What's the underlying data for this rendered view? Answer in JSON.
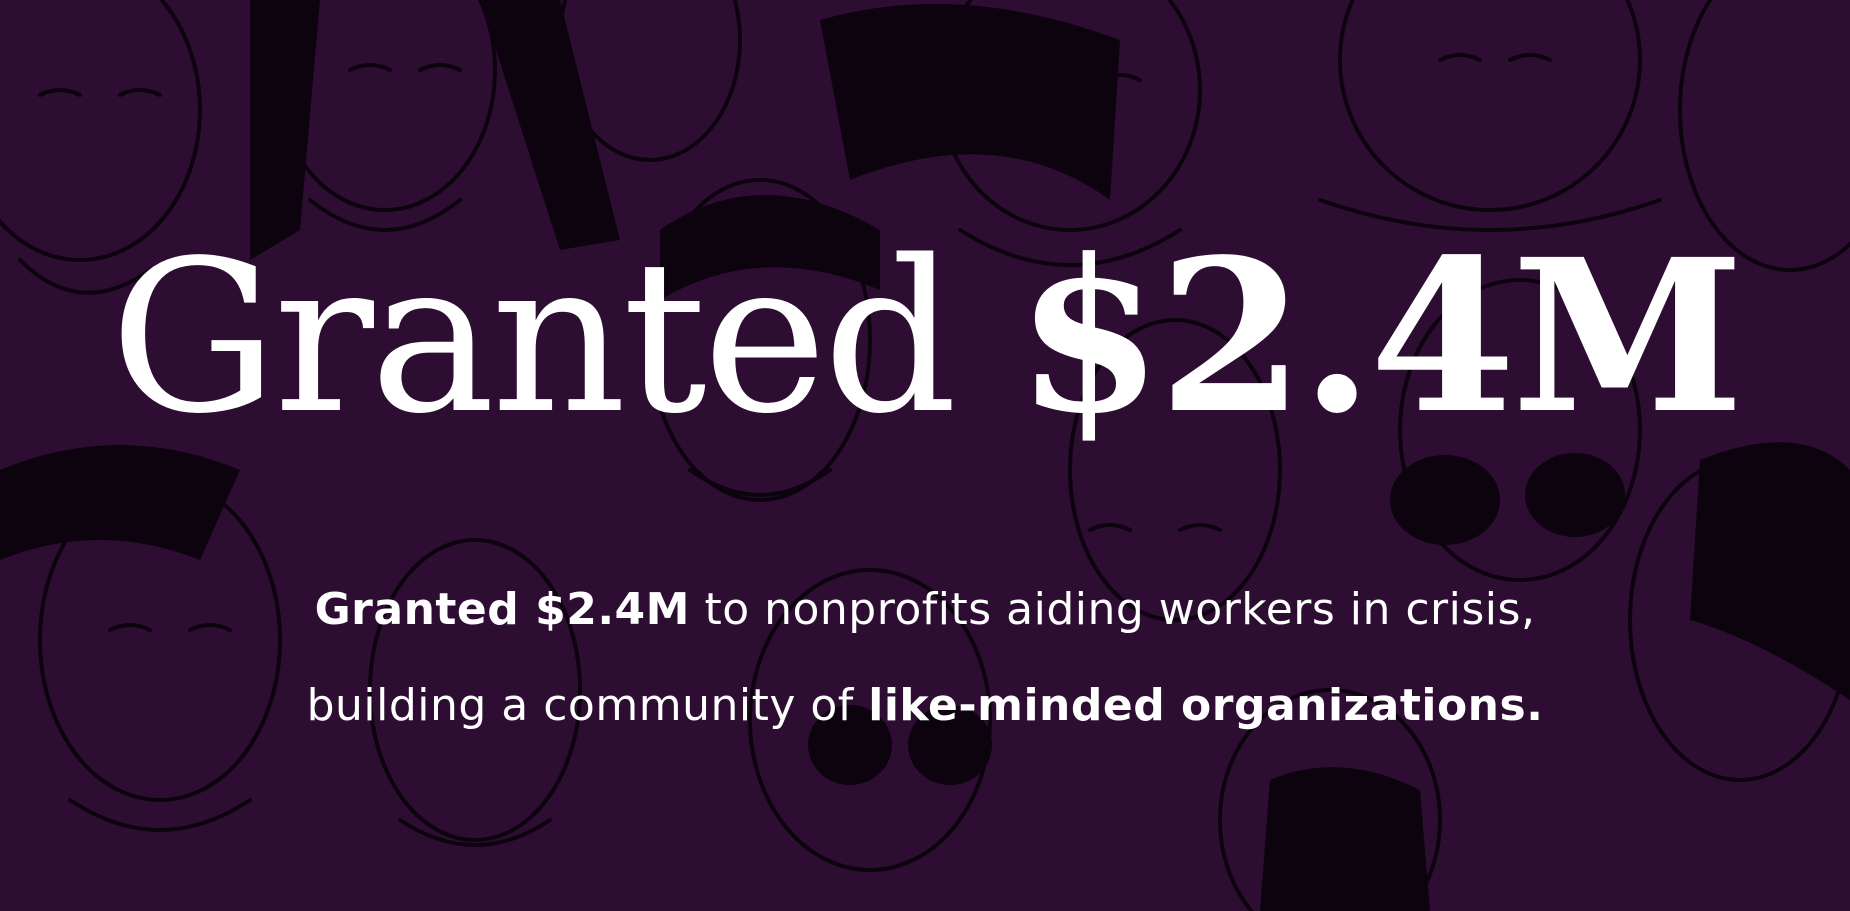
{
  "hero": {
    "headline": {
      "lead": "Granted",
      "amount": "$2.4M"
    },
    "subtext": {
      "line1_bold": "Granted $2.4M",
      "line1_rest": "to nonprofits aiding workers in crisis,",
      "line2_rest": "building a community of",
      "line2_bold": "like-minded organizations."
    }
  },
  "colors": {
    "background": "#2e0d33",
    "illustration_line": "#0c030e",
    "text": "#ffffff"
  }
}
